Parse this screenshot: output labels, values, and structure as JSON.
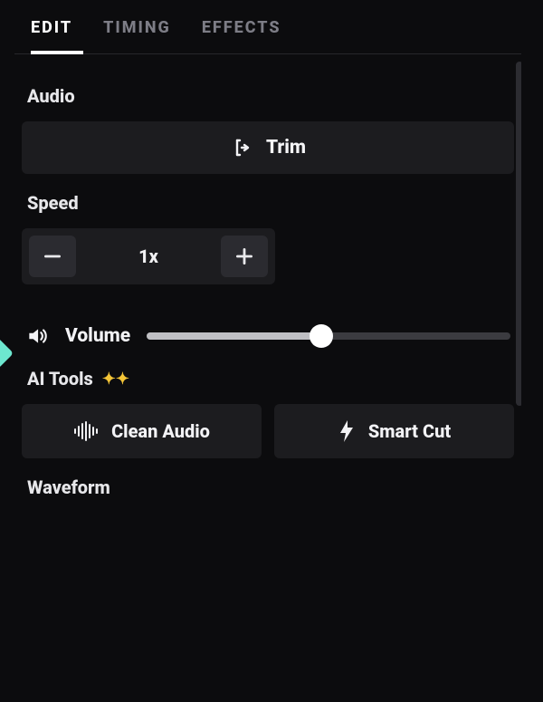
{
  "tabs": [
    {
      "label": "EDIT",
      "active": true
    },
    {
      "label": "TIMING",
      "active": false
    },
    {
      "label": "EFFECTS",
      "active": false
    }
  ],
  "sections": {
    "audio": {
      "label": "Audio",
      "trim_label": "Trim"
    },
    "speed": {
      "label": "Speed",
      "value": "1x"
    },
    "volume": {
      "label": "Volume",
      "percent": 48
    },
    "ai_tools": {
      "label": "AI Tools",
      "clean_audio_label": "Clean Audio",
      "smart_cut_label": "Smart Cut"
    },
    "waveform": {
      "label": "Waveform"
    }
  }
}
